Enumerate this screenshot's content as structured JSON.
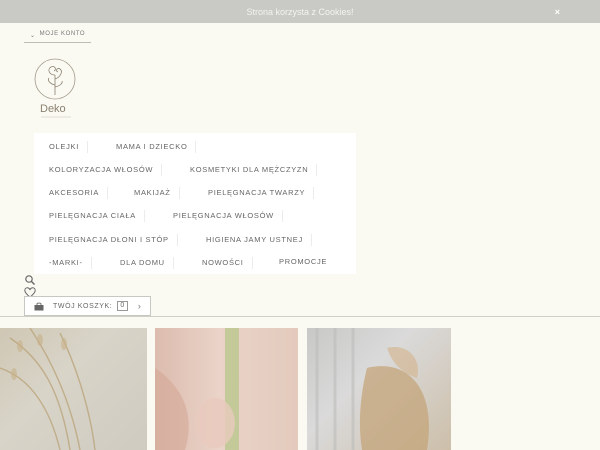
{
  "cookie_bar": {
    "text": "Strona korzysta z Cookies!",
    "close_label": "×"
  },
  "account": {
    "label": "MOJE KONTO",
    "chevron": "⌄"
  },
  "logo": {
    "text": "Deko"
  },
  "menu": {
    "items": [
      "OLEJKI",
      "MAMA I DZIECKO",
      "KOLORYZACJA WŁOSÓW",
      "KOSMETYKI DLA MĘŻCZYZN",
      "AKCESORIA",
      "MAKIJAŻ",
      "PIELĘGNACJA TWARZY",
      "PIELĘGNACJA CIAŁA",
      "PIELĘGNACJA WŁOSÓW",
      "PIELĘGNACJA DŁONI I STÓP",
      "HIGIENA JAMY USTNEJ",
      "-MARKI-",
      "DLA DOMU",
      "NOWOŚCI",
      "PROMOCJE"
    ]
  },
  "icons": {
    "search": "search-icon",
    "wishlist": "heart-icon",
    "cart": "bag-icon"
  },
  "cart": {
    "label": "TWÓJ KOSZYK:",
    "count": "0",
    "arrow": "›"
  },
  "colors": {
    "cookie_bar": "#c9c9c5",
    "background": "#fbfaf2",
    "menu_bg": "#ffffff"
  }
}
